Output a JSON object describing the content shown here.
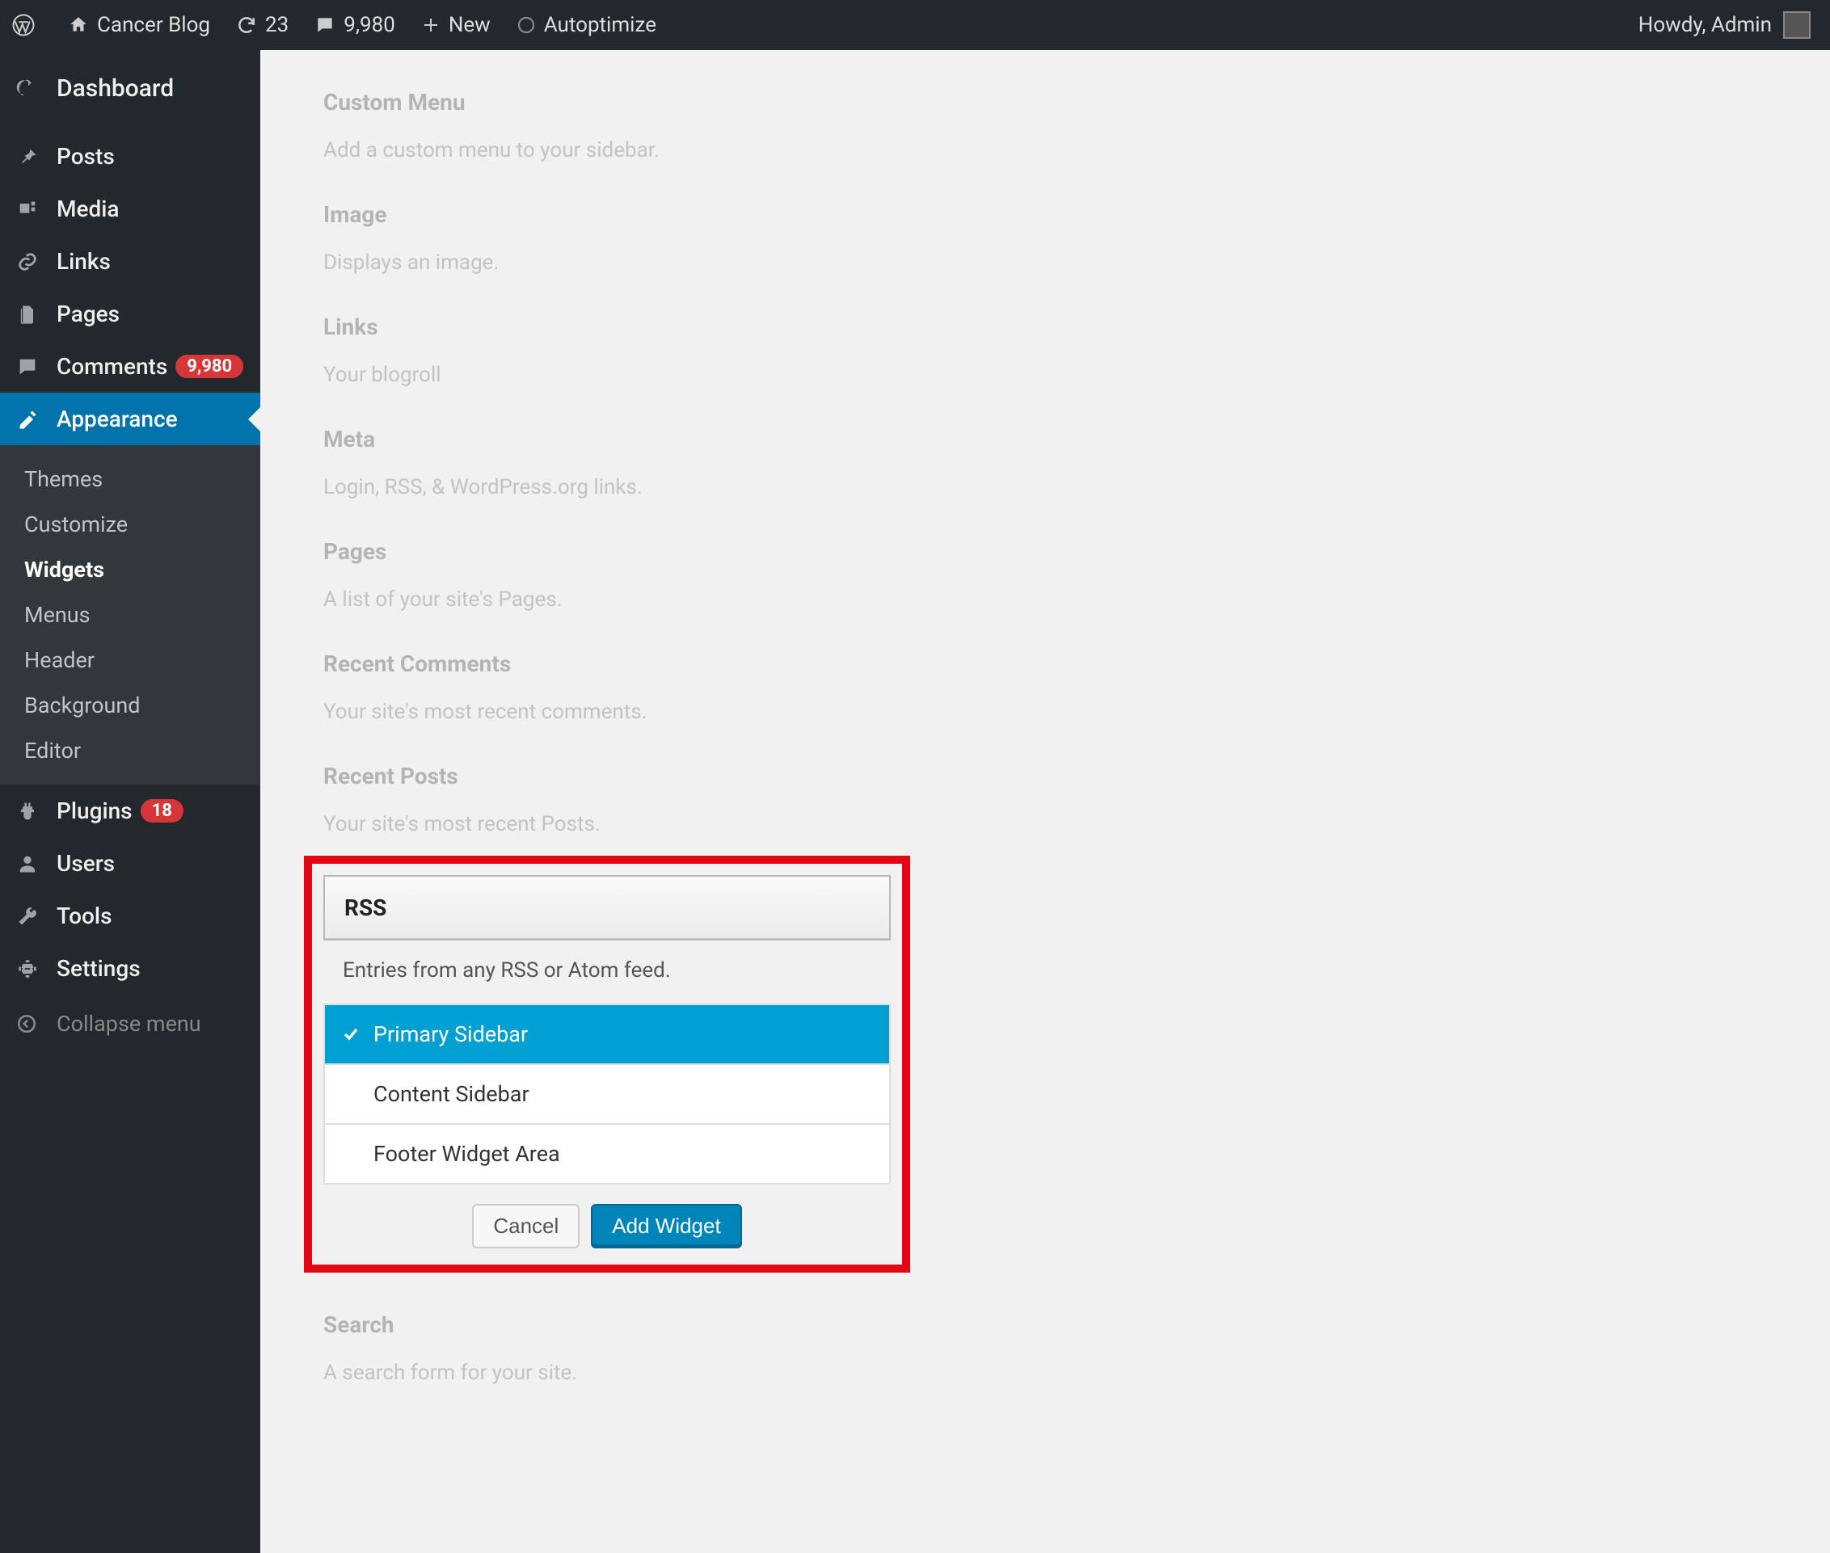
{
  "adminbar": {
    "site_name": "Cancer Blog",
    "updates_count": "23",
    "comments_count": "9,980",
    "new_label": "New",
    "autoptimize_label": "Autoptimize",
    "greeting": "Howdy, Admin"
  },
  "menu": {
    "dashboard": "Dashboard",
    "posts": "Posts",
    "media": "Media",
    "links": "Links",
    "pages": "Pages",
    "comments": "Comments",
    "comments_badge": "9,980",
    "appearance": "Appearance",
    "plugins": "Plugins",
    "plugins_badge": "18",
    "users": "Users",
    "tools": "Tools",
    "settings": "Settings",
    "collapse": "Collapse menu"
  },
  "submenu": {
    "themes": "Themes",
    "customize": "Customize",
    "widgets": "Widgets",
    "menus": "Menus",
    "header": "Header",
    "background": "Background",
    "editor": "Editor"
  },
  "widgets": [
    {
      "title": "Custom Menu",
      "desc": "Add a custom menu to your sidebar."
    },
    {
      "title": "Image",
      "desc": "Displays an image."
    },
    {
      "title": "Links",
      "desc": "Your blogroll"
    },
    {
      "title": "Meta",
      "desc": "Login, RSS, & WordPress.org links."
    },
    {
      "title": "Pages",
      "desc": "A list of your site's Pages."
    },
    {
      "title": "Recent Comments",
      "desc": "Your site's most recent comments."
    },
    {
      "title": "Recent Posts",
      "desc": "Your site's most recent Posts."
    }
  ],
  "rss": {
    "title": "RSS",
    "desc": "Entries from any RSS or Atom feed.",
    "options": [
      {
        "label": "Primary Sidebar",
        "selected": true
      },
      {
        "label": "Content Sidebar",
        "selected": false
      },
      {
        "label": "Footer Widget Area",
        "selected": false
      }
    ],
    "cancel": "Cancel",
    "add": "Add Widget"
  },
  "after_widgets": [
    {
      "title": "Search",
      "desc": "A search form for your site."
    }
  ]
}
